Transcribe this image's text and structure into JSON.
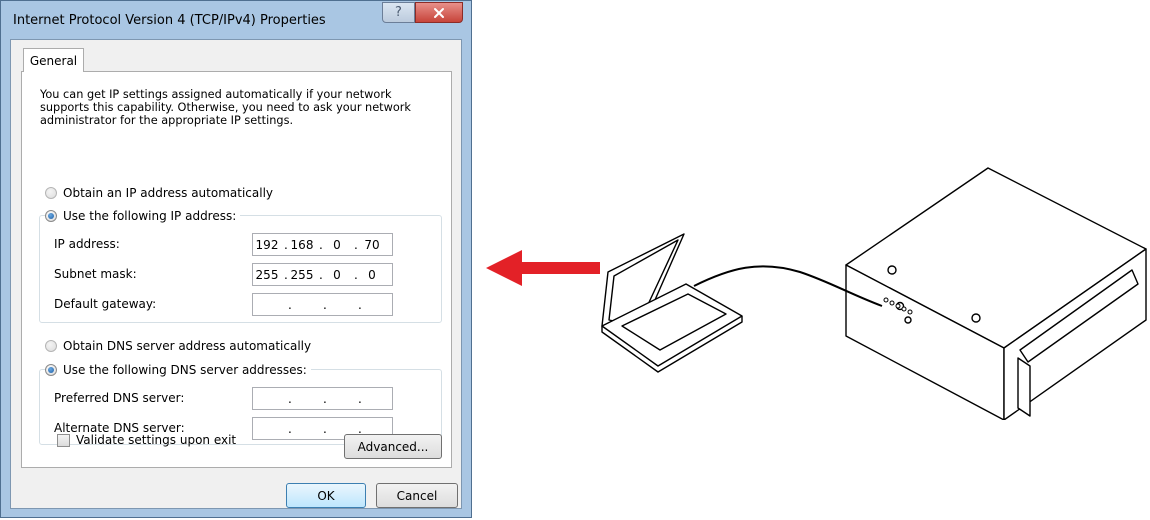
{
  "dialog": {
    "title": "Internet Protocol Version 4 (TCP/IPv4) Properties",
    "help_label": "?",
    "tab_general": "General",
    "description": "You can get IP settings assigned automatically if your network supports this capability. Otherwise, you need to ask your network administrator for the appropriate IP settings.",
    "ip_section": {
      "auto_label": "Obtain an IP address automatically",
      "auto_selected": false,
      "manual_label": "Use the following IP address:",
      "manual_selected": true,
      "fields": [
        {
          "label": "IP address:",
          "octets": [
            "192",
            "168",
            "0",
            "70"
          ]
        },
        {
          "label": "Subnet mask:",
          "octets": [
            "255",
            "255",
            "0",
            "0"
          ]
        },
        {
          "label": "Default gateway:",
          "octets": [
            "",
            "",
            "",
            ""
          ]
        }
      ]
    },
    "dns_section": {
      "auto_label": "Obtain DNS server address automatically",
      "auto_selected": false,
      "manual_label": "Use the following DNS server addresses:",
      "manual_selected": true,
      "fields": [
        {
          "label": "Preferred DNS server:",
          "octets": [
            "",
            "",
            "",
            ""
          ]
        },
        {
          "label": "Alternate DNS server:",
          "octets": [
            "",
            "",
            "",
            ""
          ]
        }
      ]
    },
    "validate_label": "Validate settings upon exit",
    "validate_checked": false,
    "advanced_label": "Advanced...",
    "ok_label": "OK",
    "cancel_label": "Cancel"
  },
  "colors": {
    "frame": "#a9c6e3",
    "close_button": "#c7443a",
    "arrow": "#e32127"
  },
  "icons": [
    "help-icon",
    "close-icon",
    "left-arrow-icon"
  ]
}
